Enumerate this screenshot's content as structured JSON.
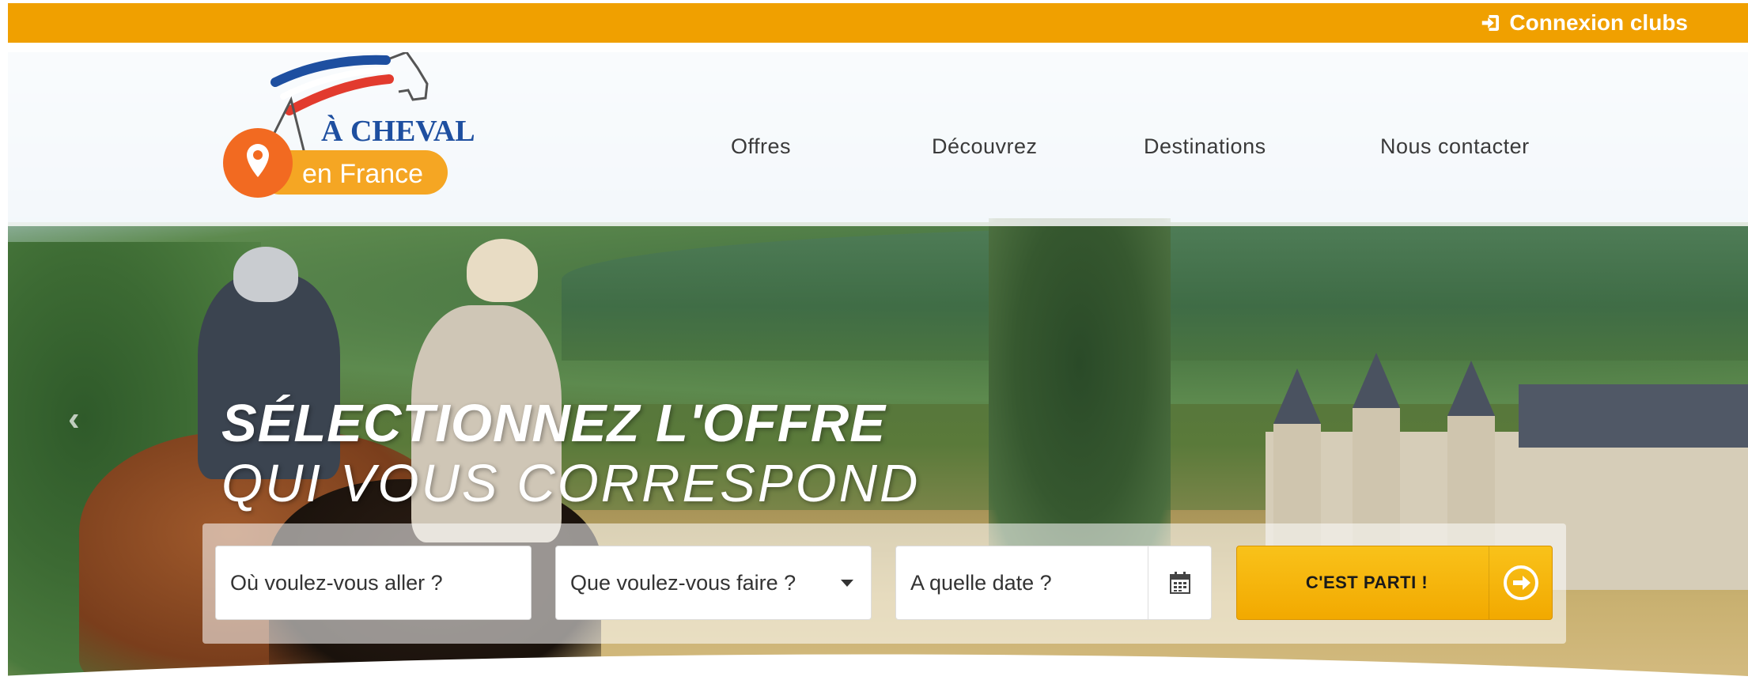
{
  "topbar": {
    "login_label": "Connexion clubs",
    "login_icon": "sign-in-icon",
    "bg_color": "#f0a000"
  },
  "logo": {
    "line1": "À CHEVAL",
    "line2": "en France",
    "pin_color": "#f26a21",
    "brand_blue": "#1e4fa0"
  },
  "nav": {
    "items": [
      {
        "label": "Offres"
      },
      {
        "label": "Découvrez"
      },
      {
        "label": "Destinations"
      },
      {
        "label": "Nous contacter"
      }
    ]
  },
  "hero": {
    "headline_line1": "SÉLECTIONNEZ L'OFFRE",
    "headline_line2": "QUI VOUS CORRESPOND",
    "prev_icon": "chevron-left-icon"
  },
  "search": {
    "where_placeholder": "Où voulez-vous aller ?",
    "what_placeholder": "Que voulez-vous faire ?",
    "when_placeholder": "A quelle date ?",
    "calendar_icon": "calendar-icon",
    "submit_label": "C'EST PARTI !",
    "submit_icon": "arrow-circle-right-icon",
    "accent_color": "#f2a900"
  }
}
